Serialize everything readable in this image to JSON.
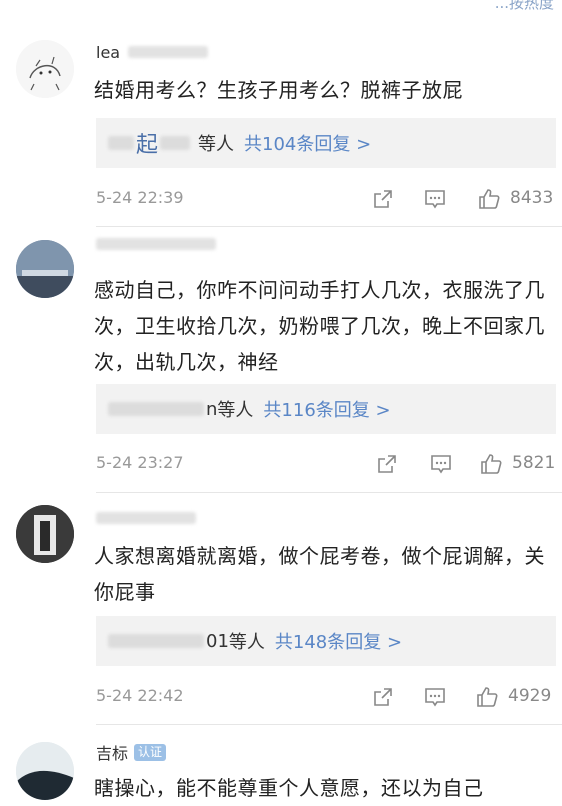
{
  "header": {
    "hint_text": "...按热度"
  },
  "comments": [
    {
      "username": "lea",
      "text": "结婚用考么？生孩子用考么？脱裤子放屁",
      "replies_who": "起",
      "replies_who_suffix": "等人",
      "replies_count": "共104条回复 >",
      "time": "5-24 22:39",
      "likes": "8433"
    },
    {
      "username": "",
      "text": "感动自己，你咋不问问动手打人几次，衣服洗了几次，卫生收拾几次，奶粉喂了几次，晚上不回家几次，出轨几次，神经",
      "replies_who": "n",
      "replies_who_suffix": "等人",
      "replies_count": "共116条回复 >",
      "time": "5-24 23:27",
      "likes": "5821"
    },
    {
      "username": "",
      "text": "人家想离婚就离婚，做个屁考卷，做个屁调解，关你屁事",
      "replies_who": "01",
      "replies_who_suffix": "等人",
      "replies_count": "共148条回复 >",
      "time": "5-24 22:42",
      "likes": "4929"
    },
    {
      "username": "吉标",
      "text": "瞎操心，能不能尊重个人意愿，还以为自己",
      "badge": "认证"
    }
  ],
  "colors": {
    "link": "#5a86c6",
    "meta": "#999999",
    "reply_bg": "#f2f2f2"
  }
}
